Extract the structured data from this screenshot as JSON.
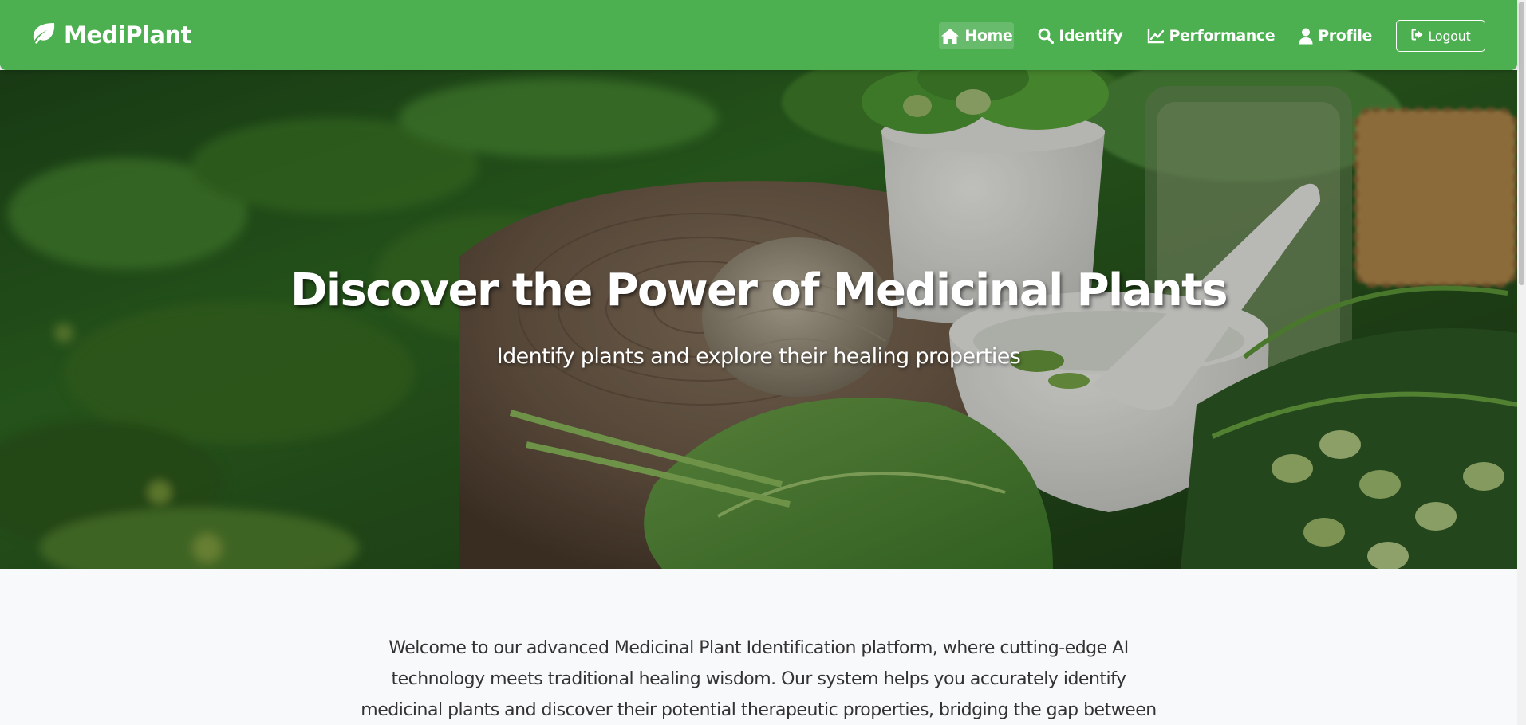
{
  "navbar": {
    "brand_name": "MediPlant",
    "brand_icon": "leaf-icon",
    "items": [
      {
        "label": "Home",
        "icon": "home-icon",
        "active": true
      },
      {
        "label": "Identify",
        "icon": "search-icon",
        "active": false
      },
      {
        "label": "Performance",
        "icon": "line-chart-icon",
        "active": false
      },
      {
        "label": "Profile",
        "icon": "user-icon",
        "active": false
      }
    ],
    "logout_label": "Logout",
    "logout_icon": "sign-out-icon",
    "background_color": "#4caf50"
  },
  "hero": {
    "title": "Discover the Power of Medicinal Plants",
    "subtitle": "Identify plants and explore their healing properties"
  },
  "intro": {
    "text": "Welcome to our advanced Medicinal Plant Identification platform, where cutting-edge AI technology meets traditional healing wisdom. Our system helps you accurately identify medicinal plants and discover their potential therapeutic properties, bridging the gap between"
  }
}
